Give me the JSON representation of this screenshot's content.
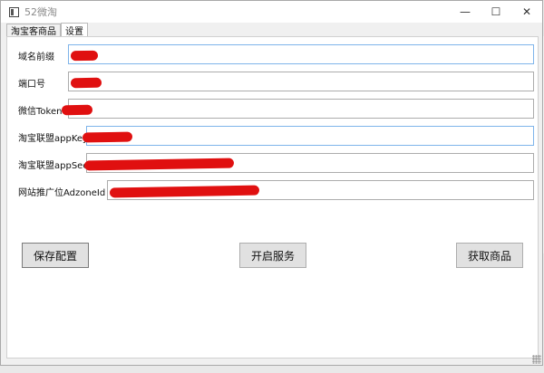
{
  "window": {
    "title": "52微淘",
    "controls": {
      "minimize": "—",
      "maximize": "☐",
      "close": "✕"
    }
  },
  "tabs": [
    {
      "label": "淘宝客商品",
      "active": false
    },
    {
      "label": "设置",
      "active": true
    }
  ],
  "form": {
    "fields": [
      {
        "label": "域名前缀",
        "value": "",
        "focused": true
      },
      {
        "label": "端口号",
        "value": "",
        "focused": false
      },
      {
        "label": "微信Token",
        "value": "",
        "focused": false
      },
      {
        "label": "淘宝联盟appKey",
        "value": "",
        "focused": true
      },
      {
        "label": "淘宝联盟appSec",
        "value": "",
        "focused": false
      },
      {
        "label": "网站推广位AdzoneId",
        "value": "",
        "focused": false
      }
    ]
  },
  "buttons": {
    "save": "保存配置",
    "start": "开启服务",
    "fetch": "获取商品"
  },
  "colors": {
    "redaction": "#e01010",
    "focus_border": "#7eb4ea",
    "button_bg": "#e1e1e1"
  }
}
